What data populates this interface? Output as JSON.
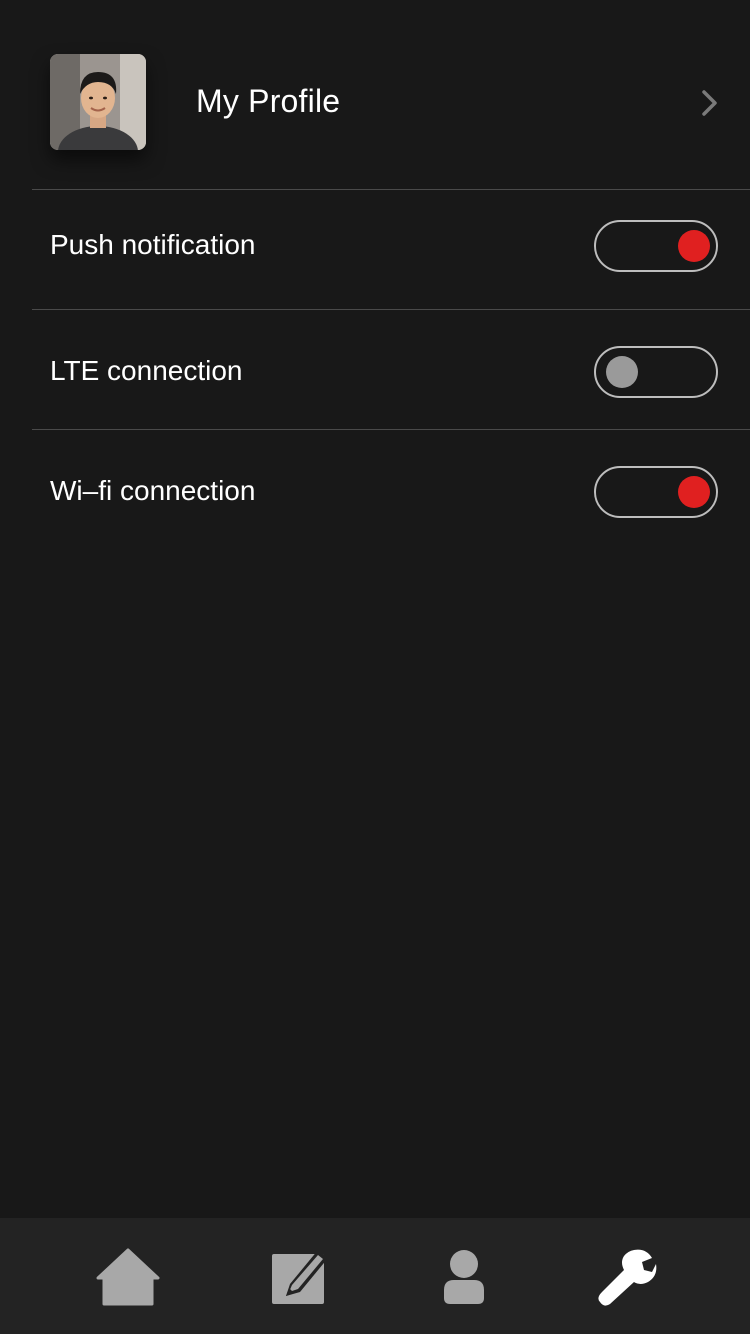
{
  "profile": {
    "label": "My Profile",
    "avatar_icon": "avatar-photo",
    "chevron_icon": "chevron-right-icon"
  },
  "settings": [
    {
      "label": "Push notification",
      "enabled": true
    },
    {
      "label": "LTE connection",
      "enabled": false
    },
    {
      "label": "Wi–fi connection",
      "enabled": true
    }
  ],
  "colors": {
    "background": "#181818",
    "tabbar": "#232323",
    "toggle_on": "#e02020",
    "toggle_off": "#9a9a9a",
    "divider": "#4a4a4a"
  },
  "tabs": [
    {
      "icon": "home-icon",
      "active": false
    },
    {
      "icon": "edit-icon",
      "active": false
    },
    {
      "icon": "user-icon",
      "active": false
    },
    {
      "icon": "wrench-icon",
      "active": true
    }
  ]
}
